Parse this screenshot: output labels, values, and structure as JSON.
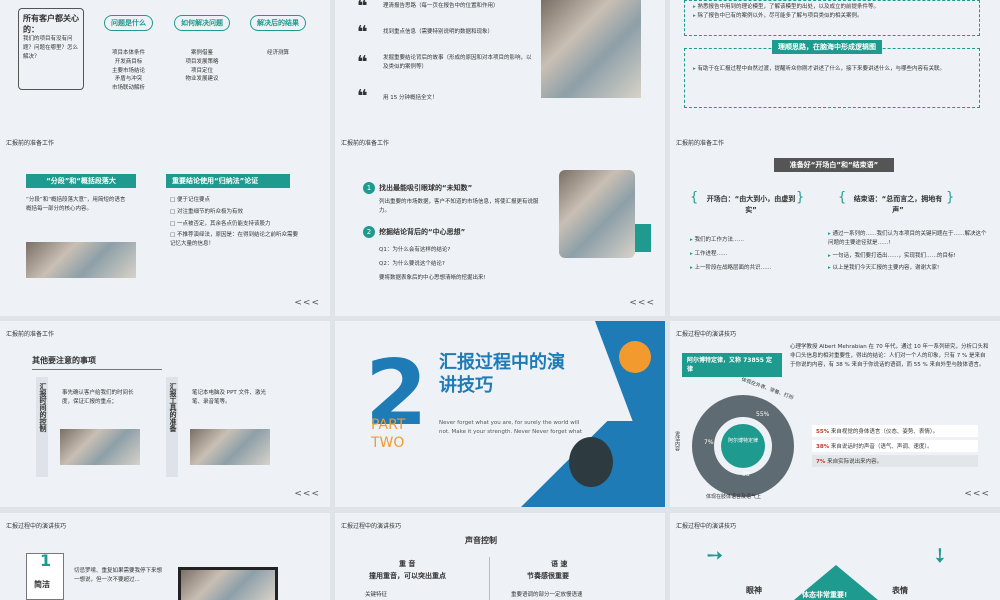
{
  "slides": {
    "s1": {
      "customer_q": "所有客户都关心的：",
      "customer_sub": "我们的项目有没有问题？问题在哪里？怎么解决？",
      "cols": [
        {
          "title": "问题是什么",
          "items": [
            "项目本体条件",
            "开发商目标",
            "主要市场结论",
            "矛盾与冲突",
            "市场联动解析"
          ]
        },
        {
          "title": "如何解决问题",
          "items": [
            "案例借鉴",
            "项目发展策略",
            "项目定位",
            "物业发展建议"
          ]
        },
        {
          "title": "解决后的结果",
          "items": [
            "经济测算"
          ]
        }
      ]
    },
    "s2": {
      "items": [
        "理清报告思路（每一页在报告中的位置和作用）",
        "找到重点信息（需要特别说明的数据和现象）",
        "发掘重要结论背后的故事（形成的原因和对本项目的影响，以及类似的案例等）",
        "用 15 分钟概括全文！"
      ]
    },
    "s3": {
      "items_top": [
        "熟悉报告中用到的理论模型，了解该模型的出处，以及成立的前提条件等。",
        "除了报告中已有的案例以外，尽可能多了解与项目类似的相关案例。"
      ],
      "banner": "理顺思路，在脑海中形成逻辑图",
      "item_bottom": "有助于在汇报过程中自然过渡，提醒听众你刚才讲述了什么，接下来要讲述什么，与哪些内容有关联。"
    },
    "s4": {
      "header": "汇报前的准备工作",
      "tag1": "“分段”和“概括段落大",
      "text1": "“分段”和“概括段落大意”，用简短的语言概括每一部分的核心内容。",
      "tag2": "重要结论使用“归纳法”论证",
      "bullets": [
        "便于记住要点",
        "对注重细节的听众极为有效",
        "一点被否定，其余各点仍能支持该股力",
        "不推荐演绎法，原因是：在得到结论之前听众需要记忆大量的信息！"
      ]
    },
    "s5": {
      "header": "汇报前的准备工作",
      "n1": "1",
      "t1": "找出最能吸引眼球的“未知数”",
      "d1": "列出重要的市场数据，客户不知道的市场信息，将使汇报更有说服力。",
      "n2": "2",
      "t2": "挖掘结论背后的“中心思想”",
      "q1": "Q1：为什么会有这样的结论?",
      "q2": "Q2：为什么要说这个结论?",
      "d2": "要将数据表象后的中心思想清晰的挖掘出来!"
    },
    "s6": {
      "header": "汇报前的准备工作",
      "title": "准备好“开场白”和“结束语”",
      "open_title": "开场白：“由大到小，由虚到实”",
      "open_items": [
        "我们的工作方法……",
        "工作进程……",
        "上一阶段在战略层面的共识……"
      ],
      "close_title": "结束语：“总而言之，拥地有声”",
      "close_items": [
        "通过一系列的……我们认为本项目的关键问题在于……解决这个问题的主要途径就是……!",
        "一句话，我们要打造出……，实现我们……的目标!",
        "以上是我们今天汇报的主要内容，谢谢大家!"
      ]
    },
    "s7": {
      "header": "汇报前的准备工作",
      "title": "其他要注意的事项",
      "v1": "汇报时间的控制",
      "t1": "事先确认客户给我们的时间长度，保证汇报的重点；",
      "v2": "汇报工具的准备",
      "t2": "笔记本电脑及 PPT 文件、激光笔、录音笔等。"
    },
    "s8": {
      "num": "2",
      "title": "汇报过程中的演讲技巧",
      "part": "PART",
      "two": "TWO",
      "en": "Never forget what you are, for surely the world will not. Make it your strength. Never Never forget what"
    },
    "s9": {
      "header": "汇报过程中的演讲技巧",
      "law": "阿尔博特定律，又称 73855 定律",
      "desc": "心理学教授 Albert Mehrabian 在 70 年代，通过 10 年一系列研究，分析口头和非口头信息的相对重要性，得出的结论：人们对一个人的印象，只有 7 % 是来自于你说的内容，有 38 % 来自于你说话的语调，而 55 % 来自外型与肢体语言。",
      "center": "阿尔博特定律",
      "labels": [
        "55%",
        "7%",
        "38"
      ],
      "ring_top": "体现在外表、穿着、打扮",
      "ring_left": "说话内容",
      "ring_bottom": "体现在肢体语言及语气上",
      "legend": [
        {
          "pct": "55%",
          "text": "来自视觉的身体语言（仪态、姿势、表情）。"
        },
        {
          "pct": "38%",
          "text": "来自说话时的声音（语气、声调、速度）。"
        },
        {
          "pct": "7%",
          "text": "来自实际说出来内容。"
        }
      ]
    },
    "s10": {
      "header": "汇报过程中的演讲技巧",
      "num": "1",
      "word": "简洁",
      "text": "切忌罗嗦、重复如果需要我停下来想一想说，但一次不要超过..."
    },
    "s11": {
      "header": "汇报过程中的演讲技巧",
      "title": "声音控制",
      "c1a": "重 音",
      "c1b": "撞用重音，可以突出重点",
      "c1c": "关键特征",
      "c2a": "语 速",
      "c2b": "节奏感很重要",
      "c2c": "重要语调的部分一定放慢语速"
    },
    "s12": {
      "header": "汇报过程中的演讲技巧",
      "l": "眼神",
      "c": "体态非常重要!",
      "r": "表情"
    },
    "nav": "<<<"
  }
}
